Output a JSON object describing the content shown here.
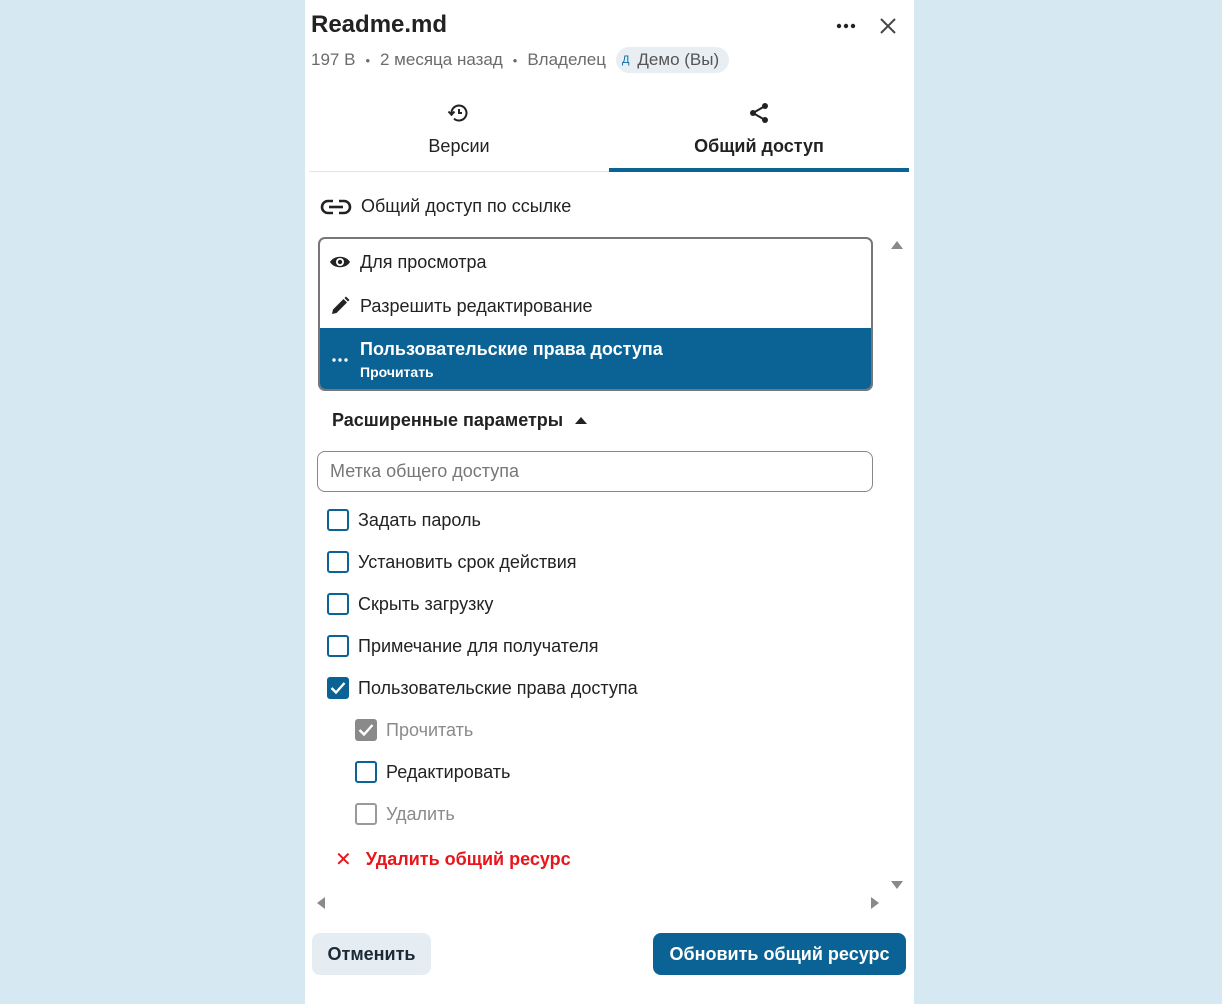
{
  "header": {
    "title": "Readme.md",
    "size": "197 B",
    "modified": "2 месяца назад",
    "owner_label": "Владелец",
    "owner_initial": "Д",
    "owner_name": "Демо (Вы)",
    "separator": "•"
  },
  "tabs": [
    {
      "label": "Версии",
      "icon": "history-icon",
      "active": false
    },
    {
      "label": "Общий доступ",
      "icon": "share-icon",
      "active": true
    }
  ],
  "link_share": {
    "label": "Общий доступ по ссылке",
    "icon": "link-icon"
  },
  "permission_menu": {
    "items": [
      {
        "label": "Для просмотра",
        "icon": "eye-icon"
      },
      {
        "label": "Разрешить редактирование",
        "icon": "pencil-icon"
      },
      {
        "label": "Пользовательские права доступа",
        "sublabel": "Прочитать",
        "icon": "more-horizontal-icon",
        "selected": true
      }
    ]
  },
  "advanced": {
    "label": "Расширенные параметры",
    "share_label_placeholder": "Метка общего доступа",
    "options": [
      {
        "label": "Задать пароль",
        "checked": false
      },
      {
        "label": "Установить срок действия",
        "checked": false
      },
      {
        "label": "Скрыть загрузку",
        "checked": false
      },
      {
        "label": "Примечание для получателя",
        "checked": false
      },
      {
        "label": "Пользовательские права доступа",
        "checked": true
      }
    ],
    "custom_permissions": [
      {
        "label": "Прочитать",
        "checked": true,
        "disabled": true
      },
      {
        "label": "Редактировать",
        "checked": false,
        "disabled": false
      },
      {
        "label": "Удалить",
        "checked": false,
        "disabled": true
      }
    ]
  },
  "delete_share": {
    "label": "Удалить общий ресурс",
    "color": "#e8151b"
  },
  "footer": {
    "cancel_label": "Отменить",
    "update_label": "Обновить общий ресурс"
  },
  "colors": {
    "accent": "#0a6295",
    "background": "#d6e9f2"
  }
}
